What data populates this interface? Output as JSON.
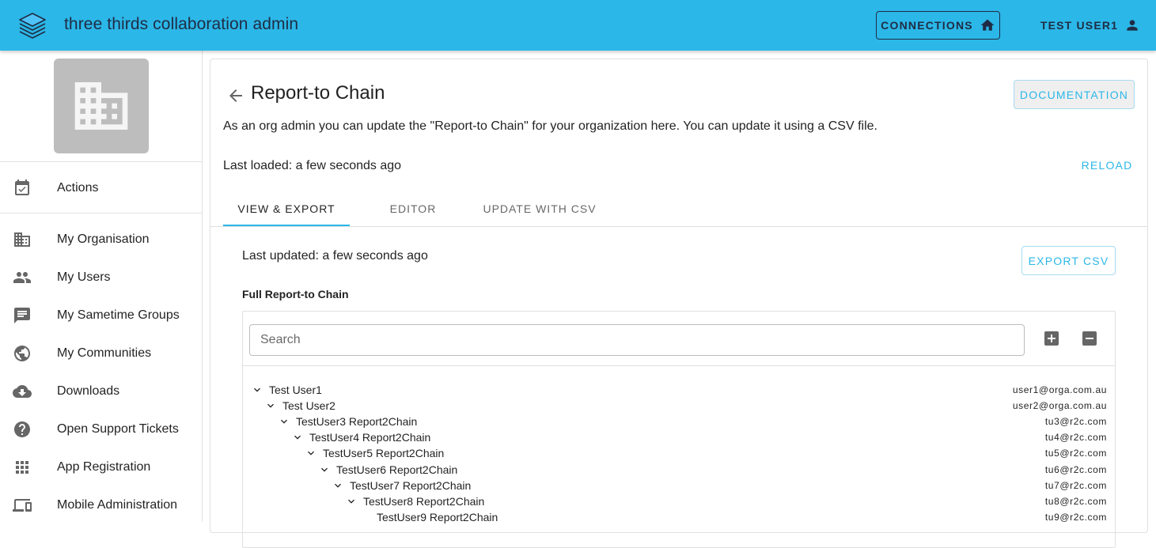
{
  "appbar": {
    "title": "three thirds collaboration admin",
    "connections_label": "Connections",
    "user_label": "Test User1",
    "bg_color": "#2bb7e8"
  },
  "sidebar": {
    "items": [
      {
        "label": "Actions",
        "icon": "calendar-check-icon"
      },
      {
        "label": "My Organisation",
        "icon": "domain-icon"
      },
      {
        "label": "My Users",
        "icon": "people-icon"
      },
      {
        "label": "My Sametime Groups",
        "icon": "chat-icon"
      },
      {
        "label": "My Communities",
        "icon": "globe-icon"
      },
      {
        "label": "Downloads",
        "icon": "cloud-download-icon"
      },
      {
        "label": "Open Support Tickets",
        "icon": "help-icon"
      },
      {
        "label": "App Registration",
        "icon": "apps-icon"
      },
      {
        "label": "Mobile Administration",
        "icon": "devices-icon"
      }
    ]
  },
  "main": {
    "title": "Report-to Chain",
    "documentation_label": "Documentation",
    "description": "As an org admin you can update the \"Report-to Chain\" for your organization here. You can update it using a CSV file.",
    "last_loaded": "Last loaded: a few seconds ago",
    "reload_label": "Reload",
    "tabs": [
      {
        "label": "View & Export",
        "active": true
      },
      {
        "label": "Editor",
        "active": false
      },
      {
        "label": "Update with CSV",
        "active": false
      }
    ],
    "last_updated": "Last updated: a few seconds ago",
    "export_label": "Export CSV",
    "section_title": "Full Report-to Chain",
    "search_placeholder": "Search",
    "tree": [
      {
        "name": "Test User1",
        "email": "user1@orga.com.au",
        "depth": 0,
        "expanded": true
      },
      {
        "name": "Test User2",
        "email": "user2@orga.com.au",
        "depth": 1,
        "expanded": true
      },
      {
        "name": "TestUser3 Report2Chain",
        "email": "tu3@r2c.com",
        "depth": 2,
        "expanded": true
      },
      {
        "name": "TestUser4 Report2Chain",
        "email": "tu4@r2c.com",
        "depth": 3,
        "expanded": true
      },
      {
        "name": "TestUser5 Report2Chain",
        "email": "tu5@r2c.com",
        "depth": 4,
        "expanded": true
      },
      {
        "name": "TestUser6 Report2Chain",
        "email": "tu6@r2c.com",
        "depth": 5,
        "expanded": true
      },
      {
        "name": "TestUser7 Report2Chain",
        "email": "tu7@r2c.com",
        "depth": 6,
        "expanded": true
      },
      {
        "name": "TestUser8 Report2Chain",
        "email": "tu8@r2c.com",
        "depth": 7,
        "expanded": true
      },
      {
        "name": "TestUser9 Report2Chain",
        "email": "tu9@r2c.com",
        "depth": 8,
        "expanded": null
      }
    ]
  }
}
